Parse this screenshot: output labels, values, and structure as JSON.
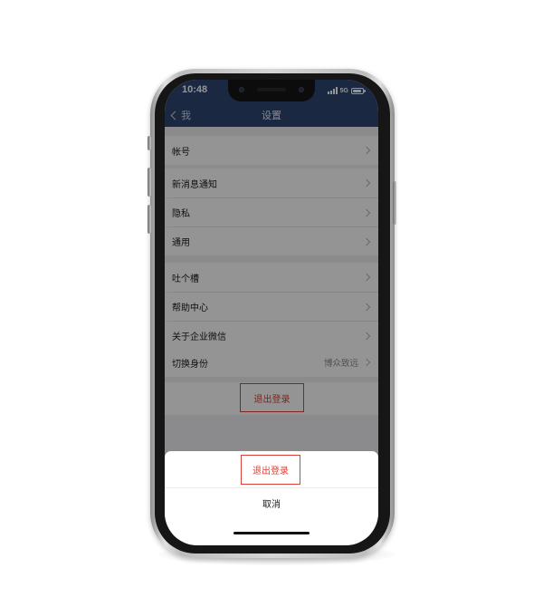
{
  "status_bar": {
    "time": "10:48",
    "network": "5G"
  },
  "nav": {
    "back_label": "我",
    "title": "设置"
  },
  "settings": {
    "account": "帐号",
    "notifications": "新消息通知",
    "privacy": "隐私",
    "general": "通用",
    "feedback": "吐个槽",
    "help": "帮助中心",
    "about": "关于企业微信",
    "switch_identity": "切换身份",
    "switch_identity_value": "博众致远",
    "logout": "退出登录"
  },
  "action_sheet": {
    "logout": "退出登录",
    "cancel": "取消"
  },
  "colors": {
    "navbar": "#2d4771",
    "destructive": "#d9423a",
    "page_background": "#efeff4"
  }
}
